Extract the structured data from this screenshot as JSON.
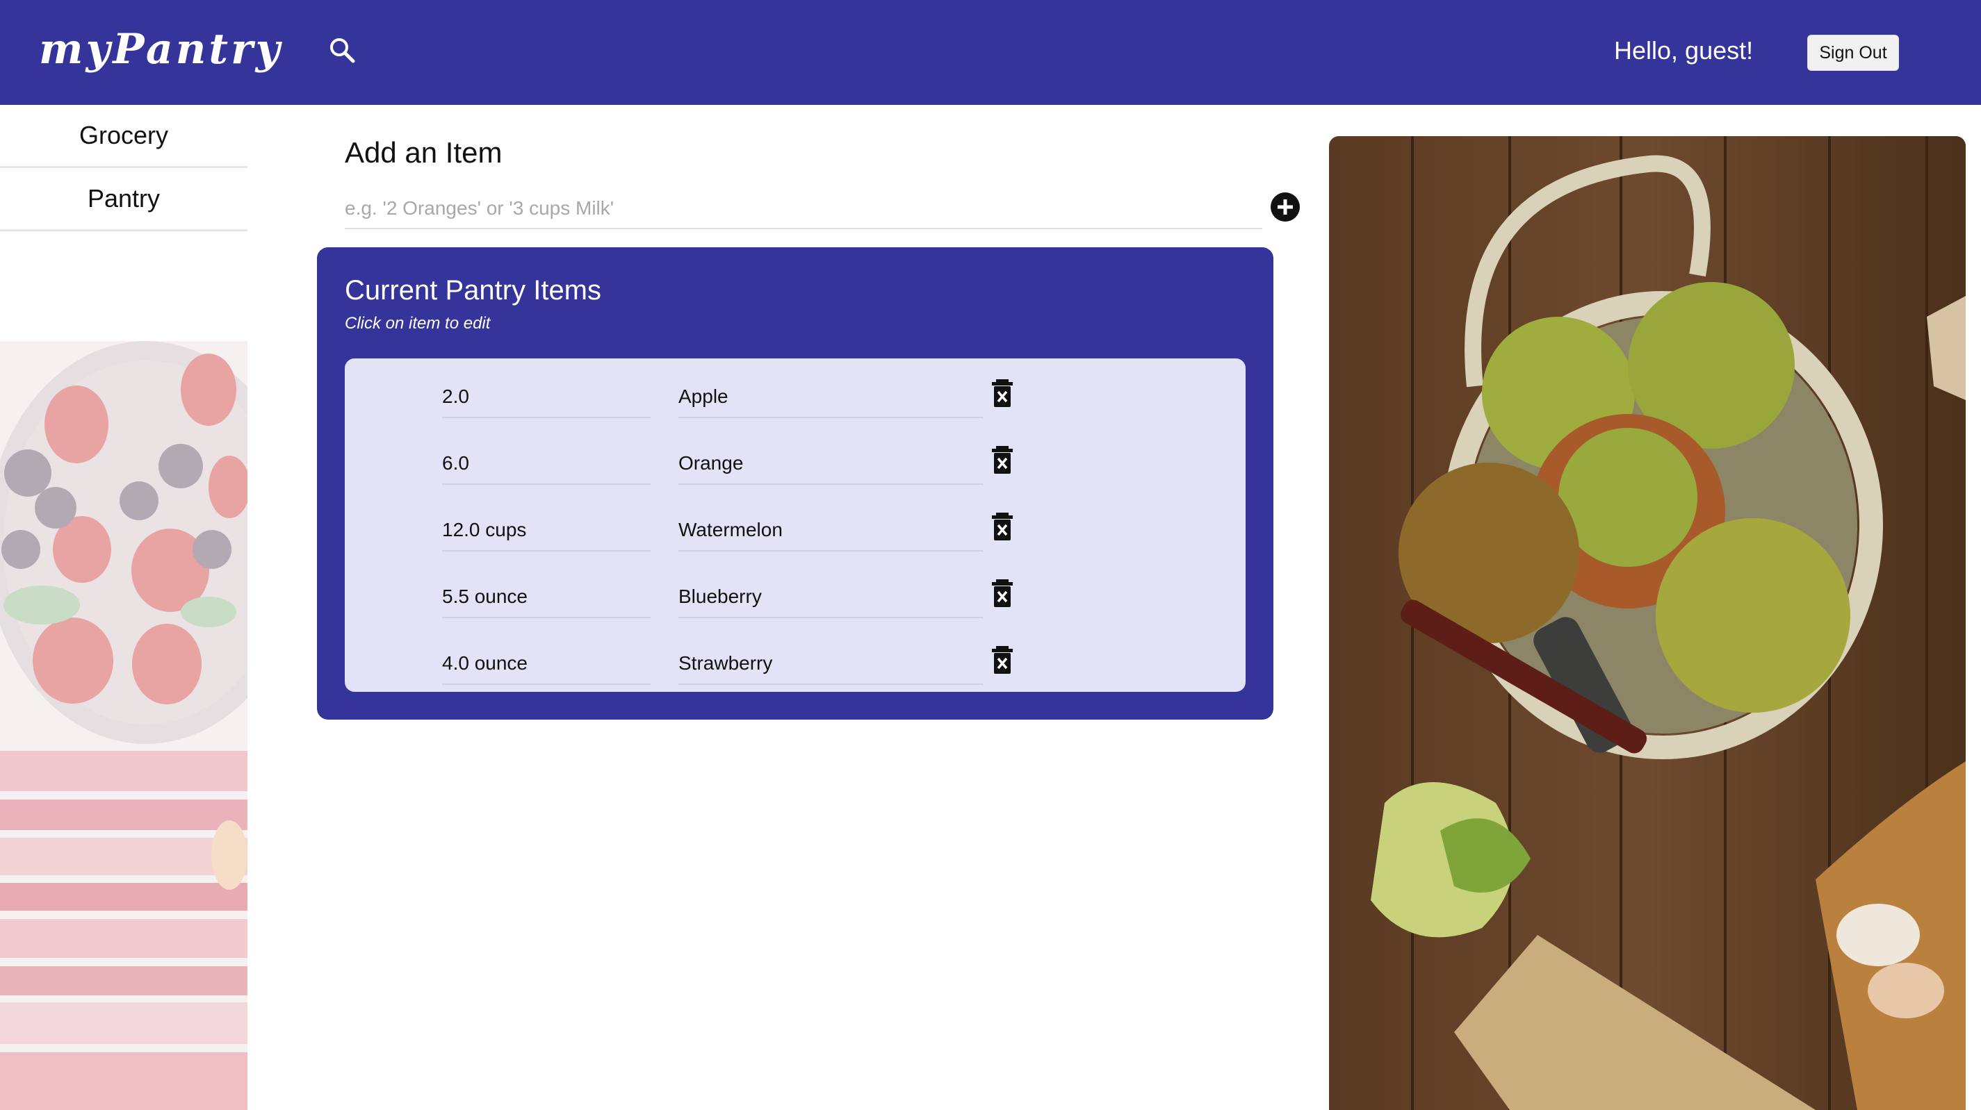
{
  "header": {
    "logo": "myPantry",
    "greeting": "Hello, guest!",
    "signout_label": "Sign Out"
  },
  "sidebar": {
    "items": [
      {
        "label": "Grocery"
      },
      {
        "label": "Pantry"
      }
    ]
  },
  "add_item": {
    "title": "Add an Item",
    "placeholder": "e.g. '2 Oranges' or '3 cups Milk'",
    "value": ""
  },
  "pantry": {
    "title": "Current Pantry Items",
    "subtitle": "Click on item to edit",
    "items": [
      {
        "quantity": "2.0",
        "name": "Apple"
      },
      {
        "quantity": "6.0",
        "name": "Orange"
      },
      {
        "quantity": "12.0 cups",
        "name": "Watermelon"
      },
      {
        "quantity": "5.5 ounce",
        "name": "Blueberry"
      },
      {
        "quantity": "4.0 ounce",
        "name": "Strawberry"
      }
    ]
  },
  "colors": {
    "header_bg": "#34349a",
    "list_bg": "#e3e3f7"
  },
  "icons": [
    "search-icon",
    "add-circle-icon",
    "delete-icon"
  ]
}
